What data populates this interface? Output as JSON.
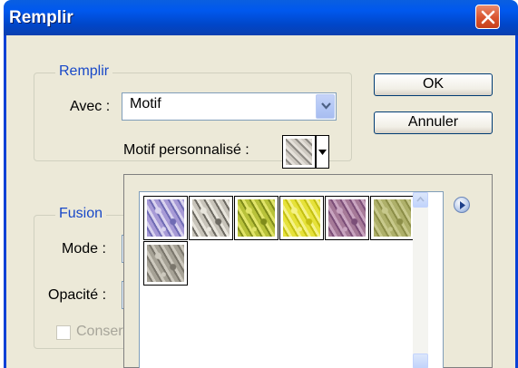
{
  "dialog": {
    "title": "Remplir",
    "close_icon": "close-icon"
  },
  "fill_group": {
    "legend": "Remplir",
    "with_label": "Avec :",
    "with_value": "Motif",
    "custom_pattern_label": "Motif personnalisé :"
  },
  "buttons": {
    "ok": "OK",
    "cancel": "Annuler"
  },
  "blend_group": {
    "legend": "Fusion",
    "mode_label": "Mode :",
    "opacity_label": "Opacité :",
    "preserve_label": "Conserv"
  },
  "pattern_picker": {
    "menu_icon": "flyout-arrow-icon",
    "patterns": [
      {
        "name": "purple-flowers",
        "colors": [
          "#a79ad6",
          "#6f6bb4",
          "#d9d3ee"
        ]
      },
      {
        "name": "gray-granite",
        "colors": [
          "#c8c4ba",
          "#6d6a62",
          "#e9e6dd"
        ]
      },
      {
        "name": "green-yellow",
        "colors": [
          "#b8c23a",
          "#7f8b1a",
          "#e1e46a"
        ]
      },
      {
        "name": "yellow-blossom",
        "colors": [
          "#e6e23a",
          "#c4c012",
          "#f5f28a"
        ]
      },
      {
        "name": "pink-purple",
        "colors": [
          "#a67a98",
          "#7b4e78",
          "#c9a5c0"
        ]
      },
      {
        "name": "olive-moss",
        "colors": [
          "#aeb06a",
          "#8c8e48",
          "#c8c98c"
        ]
      },
      {
        "name": "gray-stone",
        "colors": [
          "#a6a296",
          "#7a766c",
          "#cdc9be"
        ]
      }
    ]
  }
}
